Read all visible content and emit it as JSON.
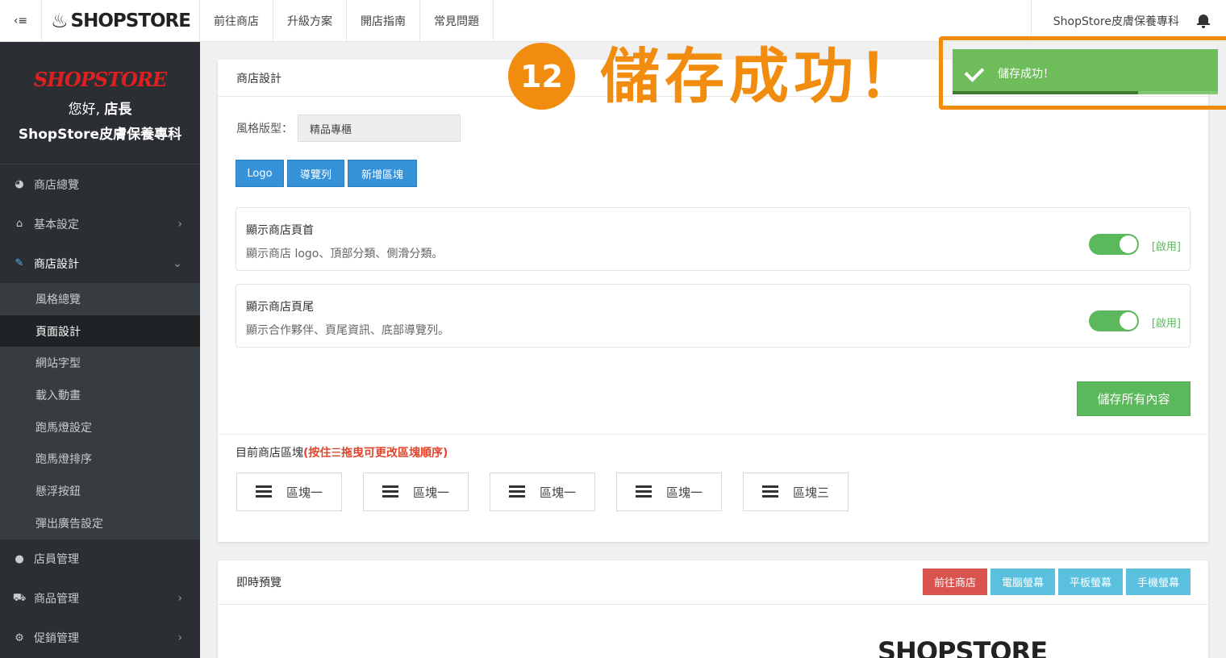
{
  "topbar": {
    "toggle_glyph": "‹≡",
    "brand": "SHOPSTORE",
    "nav": [
      "前往商店",
      "升級方案",
      "開店指南",
      "常見問題"
    ],
    "store_name": "ShopStore皮膚保養專科"
  },
  "sidebar": {
    "logo": "SHOPSTORE",
    "greet_prefix": "您好,",
    "greet_user": "店長",
    "store": "ShopStore皮膚保養專科",
    "items": [
      {
        "label": "商店總覽",
        "icon": "dashboard-icon"
      },
      {
        "label": "基本設定",
        "icon": "bank-icon"
      },
      {
        "label": "商店設計",
        "icon": "magic-wand-icon"
      },
      {
        "label": "店員管理",
        "icon": "user-secret-icon"
      },
      {
        "label": "商品管理",
        "icon": "cart-icon"
      },
      {
        "label": "促銷管理",
        "icon": "gear-icon"
      }
    ],
    "sub_items": [
      "風格總覽",
      "頁面設計",
      "網站字型",
      "載入動畫",
      "跑馬燈設定",
      "跑馬燈排序",
      "懸浮按鈕",
      "彈出廣告設定"
    ]
  },
  "panel": {
    "title": "商店設計",
    "style_label": "風格版型：",
    "style_value": "精品專櫃",
    "buttons": [
      "Logo",
      "導覽列",
      "新增區塊"
    ],
    "header_toggle": {
      "title": "顯示商店頁首",
      "desc": "顯示商店 logo、頂部分類、側滑分類。",
      "state": "[啟用]"
    },
    "footer_toggle": {
      "title": "顯示商店頁尾",
      "desc": "顯示合作夥伴、頁尾資訊、底部導覽列。",
      "state": "[啟用]"
    },
    "save_all": "儲存所有內容",
    "blocks_title": "目前商店區塊",
    "blocks_hint": "(按住☰拖曳可更改區塊順序)",
    "blocks": [
      "區塊一",
      "區塊一",
      "區塊一",
      "區塊一",
      "區塊三"
    ]
  },
  "preview": {
    "title": "即時預覽",
    "buttons": [
      "前往商店",
      "電腦螢幕",
      "平板螢幕",
      "手機螢幕"
    ],
    "logo": "SHOPSTORE"
  },
  "annotation": {
    "step": "12",
    "text": "儲存成功！"
  },
  "toast": {
    "message": "儲存成功！",
    "progress": 0.7
  },
  "colors": {
    "accent_orange": "#f28c0f",
    "success_green": "#6fbd5a",
    "primary_blue": "#3592d8",
    "sidebar_bg": "#2b2f33"
  }
}
